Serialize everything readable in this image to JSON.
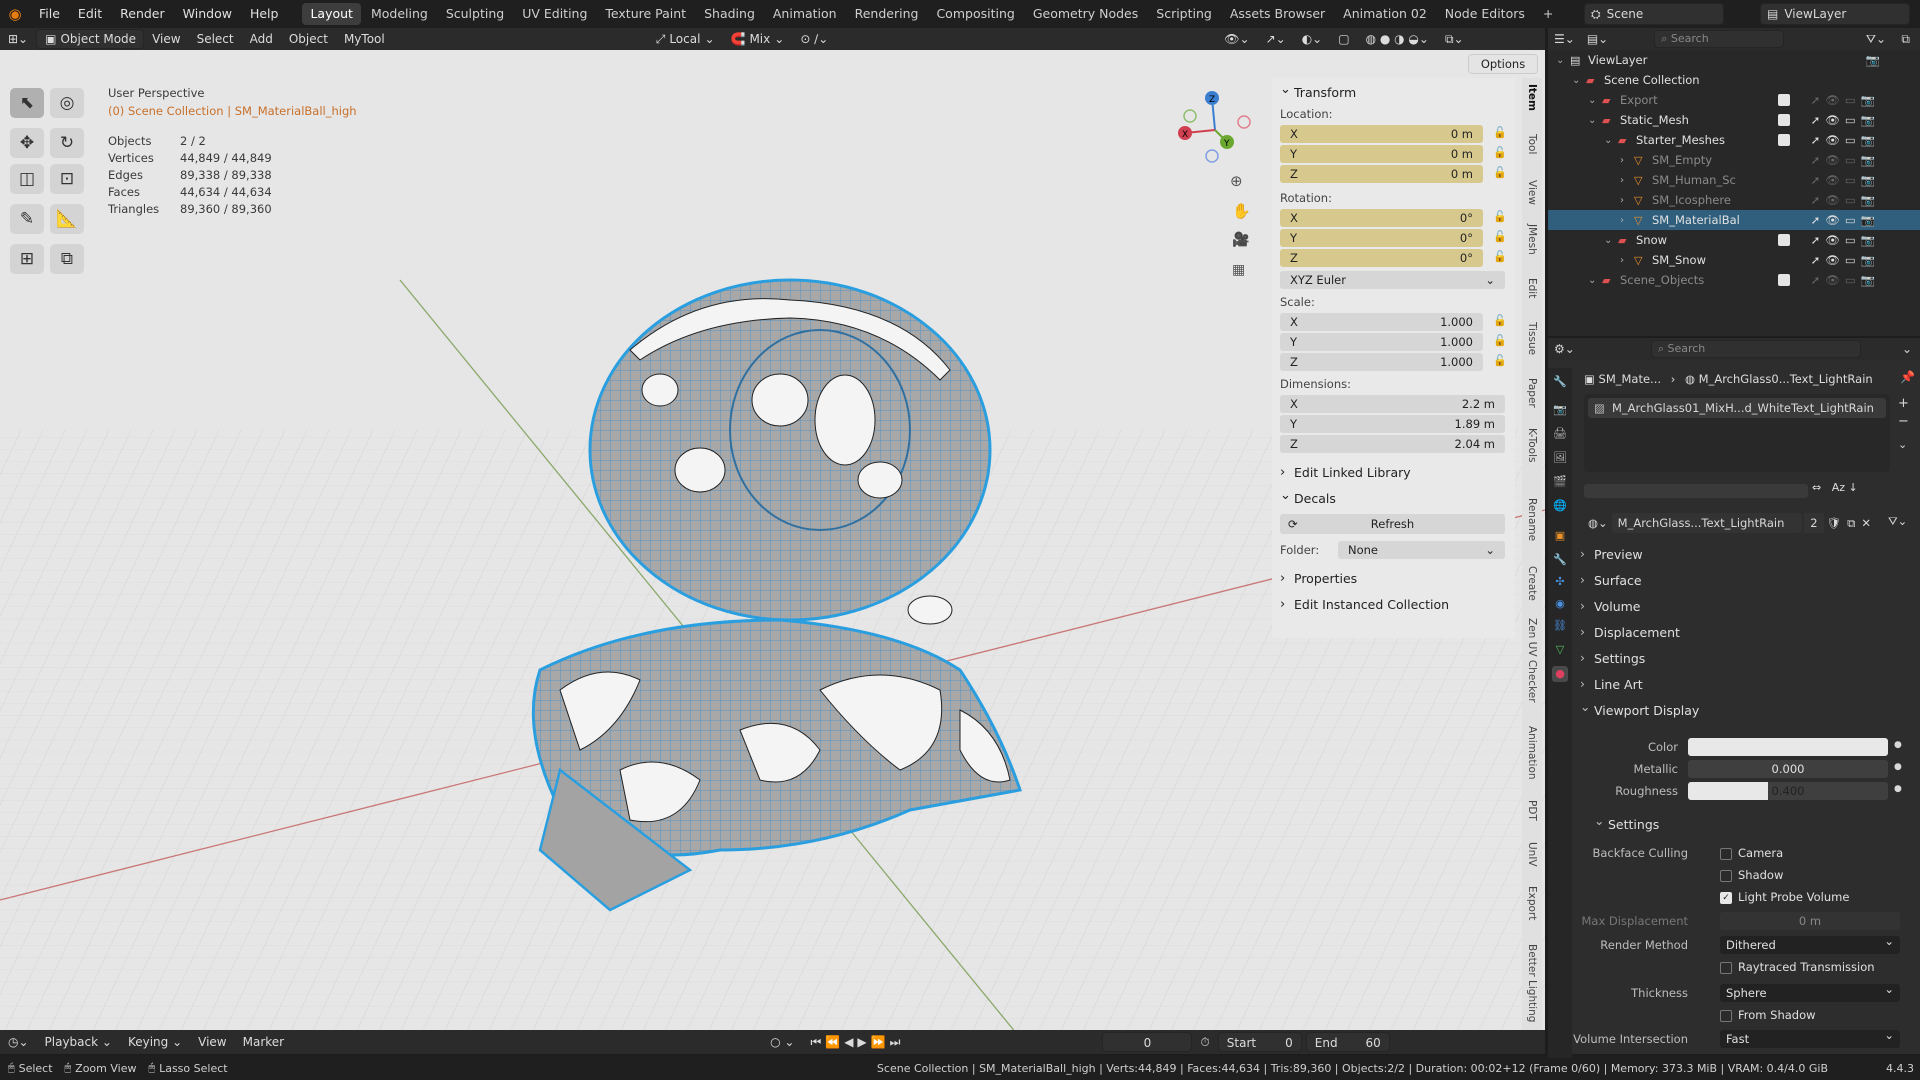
{
  "menu": {
    "items": [
      "File",
      "Edit",
      "Render",
      "Window",
      "Help"
    ]
  },
  "workspaces": {
    "tabs": [
      "Layout",
      "Modeling",
      "Sculpting",
      "UV Editing",
      "Texture Paint",
      "Shading",
      "Animation",
      "Rendering",
      "Compositing",
      "Geometry Nodes",
      "Scripting",
      "Assets Browser",
      "Animation 02",
      "Node Editors"
    ],
    "active": "Layout",
    "add": "+"
  },
  "top_right": {
    "scene": "Scene",
    "view_layer": "ViewLayer"
  },
  "header": {
    "mode": "Object Mode",
    "view": "View",
    "select": "Select",
    "add": "Add",
    "object": "Object",
    "mytool": "MyTool",
    "orientation": "Local",
    "snap": "Mix",
    "options": "Options"
  },
  "overlay": {
    "perspective": "User Perspective",
    "collection": "(0) Scene Collection | SM_MaterialBall_high"
  },
  "stats": [
    {
      "label": "Objects",
      "value": "2 / 2"
    },
    {
      "label": "Vertices",
      "value": "44,849 / 44,849"
    },
    {
      "label": "Edges",
      "value": "89,338 / 89,338"
    },
    {
      "label": "Faces",
      "value": "44,634 / 44,634"
    },
    {
      "label": "Triangles",
      "value": "89,360 / 89,360"
    }
  ],
  "gizmo": {
    "x": "X",
    "y": "Y",
    "z": "Z"
  },
  "npanel": {
    "transform_title": "Transform",
    "location_label": "Location:",
    "location": [
      {
        "axis": "X",
        "value": "0 m"
      },
      {
        "axis": "Y",
        "value": "0 m"
      },
      {
        "axis": "Z",
        "value": "0 m"
      }
    ],
    "rotation_label": "Rotation:",
    "rotation": [
      {
        "axis": "X",
        "value": "0°"
      },
      {
        "axis": "Y",
        "value": "0°"
      },
      {
        "axis": "Z",
        "value": "0°"
      }
    ],
    "rotation_mode": "XYZ Euler",
    "scale_label": "Scale:",
    "scale": [
      {
        "axis": "X",
        "value": "1.000"
      },
      {
        "axis": "Y",
        "value": "1.000"
      },
      {
        "axis": "Z",
        "value": "1.000"
      }
    ],
    "dimensions_label": "Dimensions:",
    "dimensions": [
      {
        "axis": "X",
        "value": "2.2 m"
      },
      {
        "axis": "Y",
        "value": "1.89 m"
      },
      {
        "axis": "Z",
        "value": "2.04 m"
      }
    ],
    "edit_linked": "Edit Linked Library",
    "decals": "Decals",
    "refresh": "Refresh",
    "folder_label": "Folder:",
    "folder_value": "None",
    "properties": "Properties",
    "edit_instanced": "Edit Instanced Collection"
  },
  "vertical_tabs": [
    "Item",
    "Tool",
    "View",
    "JMesh",
    "Edit",
    "Tissue",
    "Paper",
    "K-Tools",
    "Rename",
    "Create",
    "Zen UV Checker",
    "Animation",
    "PDT",
    "UnIV",
    "Export",
    "Better Lighting"
  ],
  "timeline": {
    "playback": "Playback",
    "keying": "Keying",
    "view": "View",
    "marker": "Marker",
    "frame": "0",
    "start_label": "Start",
    "start": "0",
    "end_label": "End",
    "end": "60"
  },
  "status": {
    "select": "Select",
    "zoom": "Zoom View",
    "lasso": "Lasso Select",
    "info": "Scene Collection | SM_MaterialBall_high | Verts:44,849 | Faces:44,634 | Tris:89,360 | Objects:2/2 | Duration: 00:02+12 (Frame 0/60) | Memory: 373.3 MiB | VRAM: 0.4/4.0 GiB",
    "version": "4.4.3"
  },
  "outliner": {
    "search_placeholder": "Search",
    "rows": [
      {
        "name": "ViewLayer",
        "depth": 0,
        "kind": "layer"
      },
      {
        "name": "Scene Collection",
        "depth": 1,
        "kind": "coll"
      },
      {
        "name": "Export",
        "depth": 2,
        "kind": "coll-dim"
      },
      {
        "name": "Static_Mesh",
        "depth": 2,
        "kind": "coll"
      },
      {
        "name": "Starter_Meshes",
        "depth": 3,
        "kind": "coll"
      },
      {
        "name": "SM_Empty",
        "depth": 4,
        "kind": "obj-dim"
      },
      {
        "name": "SM_Human_Sc",
        "depth": 4,
        "kind": "obj-dim"
      },
      {
        "name": "SM_Icosphere",
        "depth": 4,
        "kind": "obj-dim"
      },
      {
        "name": "SM_MaterialBal",
        "depth": 4,
        "kind": "obj-sel"
      },
      {
        "name": "Snow",
        "depth": 3,
        "kind": "coll"
      },
      {
        "name": "SM_Snow",
        "depth": 4,
        "kind": "obj"
      },
      {
        "name": "Scene_Objects",
        "depth": 2,
        "kind": "coll-dim"
      }
    ]
  },
  "properties": {
    "search_placeholder": "Search",
    "breadcrumb_obj": "SM_Mate...",
    "breadcrumb_mat": "M_ArchGlass0...Text_LightRain",
    "slot": "M_ArchGlass01_MixH...d_WhiteText_LightRain",
    "material_name": "M_ArchGlass...Text_LightRain",
    "users": "2",
    "sections": [
      "Preview",
      "Surface",
      "Volume",
      "Displacement",
      "Settings",
      "Line Art",
      "Viewport Display"
    ],
    "color_label": "Color",
    "metallic_label": "Metallic",
    "metallic": "0.000",
    "roughness_label": "Roughness",
    "roughness": "0.400",
    "roughness_fraction": 0.4,
    "settings_title": "Settings",
    "backface_label": "Backface Culling",
    "camera": "Camera",
    "shadow": "Shadow",
    "light_probe": "Light Probe Volume",
    "max_disp_label": "Max Displacement",
    "max_disp": "0 m",
    "render_method_label": "Render Method",
    "render_method": "Dithered",
    "raytraced": "Raytraced Transmission",
    "thickness_label": "Thickness",
    "thickness": "Sphere",
    "from_shadow": "From Shadow",
    "vol_int_label": "Volume Intersection",
    "vol_int": "Fast"
  }
}
